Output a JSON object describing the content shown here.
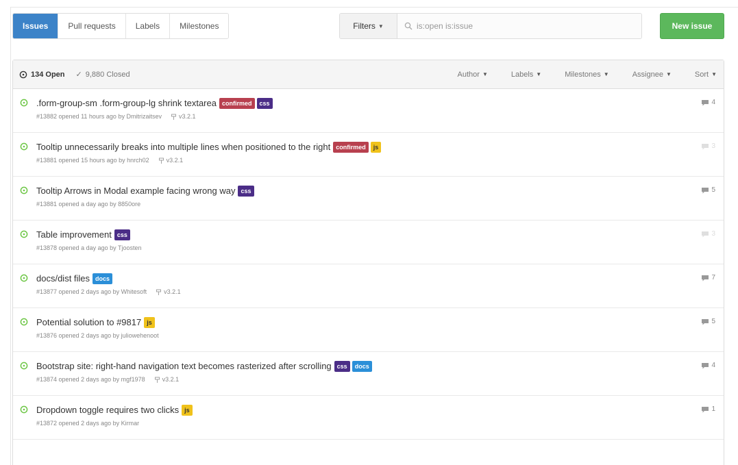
{
  "subnav": {
    "items": [
      {
        "label": "Issues",
        "selected": true
      },
      {
        "label": "Pull requests",
        "selected": false
      },
      {
        "label": "Labels",
        "selected": false
      },
      {
        "label": "Milestones",
        "selected": false
      }
    ]
  },
  "filters": {
    "button_label": "Filters",
    "search_value": "",
    "search_placeholder": "is:open is:issue"
  },
  "new_issue_label": "New issue",
  "header": {
    "open_label": "134 Open",
    "closed_label": "9,880 Closed",
    "filters": [
      "Author",
      "Labels",
      "Milestones",
      "Assignee",
      "Sort"
    ]
  },
  "colors": {
    "confirmed": "#b8404f",
    "css": "#4b2d87",
    "js": "#f0c21b",
    "docs": "#2b8fd8",
    "open_icon": "#6cc644"
  },
  "issues": [
    {
      "title": ".form-group-sm .form-group-lg shrink textarea",
      "labels": [
        {
          "text": "confirmed",
          "color": "#b8404f"
        },
        {
          "text": "css",
          "color": "#4b2d87"
        }
      ],
      "meta": "#13882 opened 11 hours ago by Dmitrizaitsev",
      "milestone": "v3.2.1",
      "comments": "4",
      "faint": false
    },
    {
      "title": "Tooltip unnecessarily breaks into multiple lines when positioned to the right",
      "labels": [
        {
          "text": "confirmed",
          "color": "#b8404f"
        },
        {
          "text": "js",
          "color": "#f0c21b"
        }
      ],
      "meta": "#13881 opened 15 hours ago by hnrch02",
      "milestone": "v3.2.1",
      "comments": "3",
      "faint": true
    },
    {
      "title": "Tooltip Arrows in Modal example facing wrong way",
      "labels": [
        {
          "text": "css",
          "color": "#4b2d87"
        }
      ],
      "meta": "#13881 opened a day ago by 8850ore",
      "milestone": "",
      "comments": "5",
      "faint": false
    },
    {
      "title": "Table improvement",
      "labels": [
        {
          "text": "css",
          "color": "#4b2d87"
        }
      ],
      "meta": "#13878 opened a day ago by Tjoosten",
      "milestone": "",
      "comments": "3",
      "faint": true
    },
    {
      "title": "docs/dist files",
      "labels": [
        {
          "text": "docs",
          "color": "#2b8fd8"
        }
      ],
      "meta": "#13877 opened 2 days ago by Whitesoft",
      "milestone": "v3.2.1",
      "comments": "7",
      "faint": false
    },
    {
      "title": "Potential solution to #9817",
      "labels": [
        {
          "text": "js",
          "color": "#f0c21b"
        }
      ],
      "meta": "#13876 opened 2 days ago by juliowehenoot",
      "milestone": "",
      "comments": "5",
      "faint": false
    },
    {
      "title": "Bootstrap site: right-hand navigation text becomes rasterized after scrolling",
      "labels": [
        {
          "text": "css",
          "color": "#4b2d87"
        },
        {
          "text": "docs",
          "color": "#2b8fd8"
        }
      ],
      "meta": "#13874 opened 2 days ago by mgf1978",
      "milestone": "v3.2.1",
      "comments": "4",
      "faint": false
    },
    {
      "title": "Dropdown toggle requires two clicks",
      "labels": [
        {
          "text": "js",
          "color": "#f0c21b"
        }
      ],
      "meta": "#13872 opened 2 days ago by Kirmar",
      "milestone": "",
      "comments": "1",
      "faint": false
    }
  ]
}
